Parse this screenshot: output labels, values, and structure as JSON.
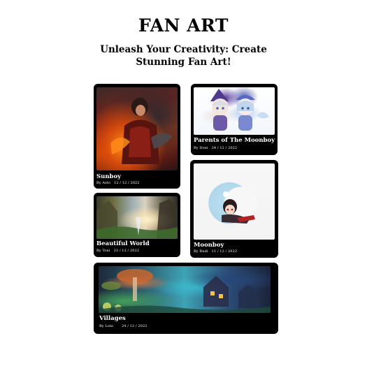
{
  "header": {
    "title": "FAN ART",
    "subtitle": "Unleash Your Creativity: Create Stunning Fan Art!"
  },
  "cards": [
    {
      "title": "Sunboy",
      "author": "By Asto",
      "date": "12 / 12 / 2022"
    },
    {
      "title": "Parents of The Moonboy",
      "author": "By Doni",
      "date": "24 / 12 / 2022"
    },
    {
      "title": "Beautiful World",
      "author": "By Toni",
      "date": "23 / 12 / 2022"
    },
    {
      "title": "Moonboy",
      "author": "By Rudi",
      "date": "11 / 12 / 2022"
    },
    {
      "title": "Villages",
      "author": "By Loni",
      "date": "24 / 12 / 2022"
    }
  ]
}
